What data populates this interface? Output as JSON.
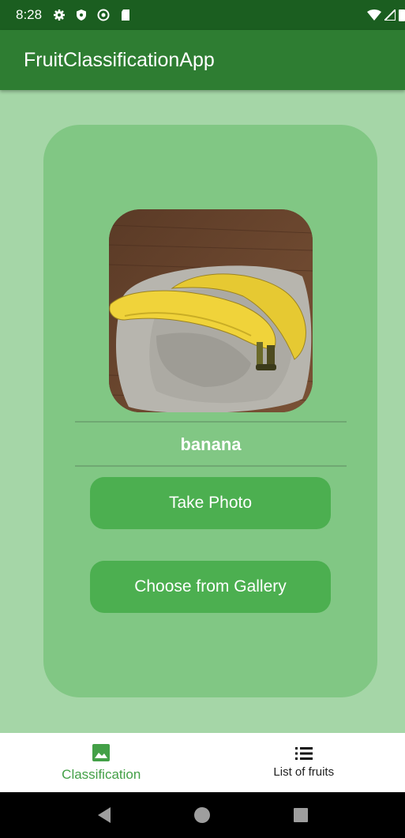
{
  "status_bar": {
    "time": "8:28",
    "icons": [
      "gear-icon",
      "shield-icon",
      "vpn-icon",
      "sd-card-icon"
    ],
    "right_icons": [
      "wifi-icon",
      "signal-icon",
      "battery-icon"
    ]
  },
  "app_bar": {
    "title": "FruitClassificationApp"
  },
  "classification": {
    "image": "banana-photo",
    "result": "banana",
    "take_photo_label": "Take Photo",
    "gallery_label": "Choose from Gallery"
  },
  "bottom_nav": {
    "items": [
      {
        "label": "Classification",
        "icon": "image-icon",
        "active": true
      },
      {
        "label": "List of fruits",
        "icon": "list-icon",
        "active": false
      }
    ]
  },
  "system_nav": {
    "icons": [
      "back-icon",
      "home-icon",
      "recents-icon"
    ]
  },
  "colors": {
    "status_bar": "#1b5e20",
    "app_bar": "#2e7d32",
    "background": "#a5d6a7",
    "card": "#81c784",
    "button": "#4caf50",
    "active_nav": "#43a047"
  }
}
